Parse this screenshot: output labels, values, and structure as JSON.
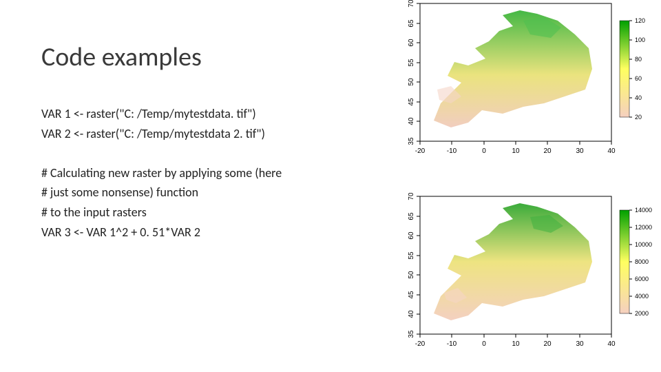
{
  "title": "Code examples",
  "code": {
    "l1": "VAR 1 <- raster(\"C: /Temp/mytestdata. tif\")",
    "l2": "VAR 2 <- raster(\"C: /Temp/mytestdata 2. tif\")",
    "l3": "# Calculating new raster by applying some (here",
    "l4": "# just some nonsense) function",
    "l5": "# to the input rasters",
    "l6": "VAR 3 <- VAR 1^2 + 0. 51*VAR 2"
  },
  "chart_data": [
    {
      "type": "heatmap",
      "title": "",
      "xlabel": "",
      "ylabel": "",
      "x_ticks": [
        -20,
        -10,
        0,
        10,
        20,
        30,
        40
      ],
      "y_ticks": [
        35,
        40,
        45,
        50,
        55,
        60,
        65,
        70
      ],
      "xlim": [
        -20,
        40
      ],
      "ylim": [
        35,
        70
      ],
      "legend_values": [
        20,
        40,
        60,
        80,
        100,
        120
      ],
      "colorscale": [
        "#f5d0c0",
        "#ffff80",
        "#00b400"
      ]
    },
    {
      "type": "heatmap",
      "title": "",
      "xlabel": "",
      "ylabel": "",
      "x_ticks": [
        -20,
        -10,
        0,
        10,
        20,
        30,
        40
      ],
      "y_ticks": [
        35,
        40,
        45,
        50,
        55,
        60,
        65,
        70
      ],
      "xlim": [
        -20,
        40
      ],
      "ylim": [
        35,
        70
      ],
      "legend_values": [
        2000,
        4000,
        6000,
        8000,
        10000,
        12000,
        14000
      ],
      "colorscale": [
        "#f5d0c0",
        "#ffff80",
        "#00b400"
      ]
    }
  ]
}
